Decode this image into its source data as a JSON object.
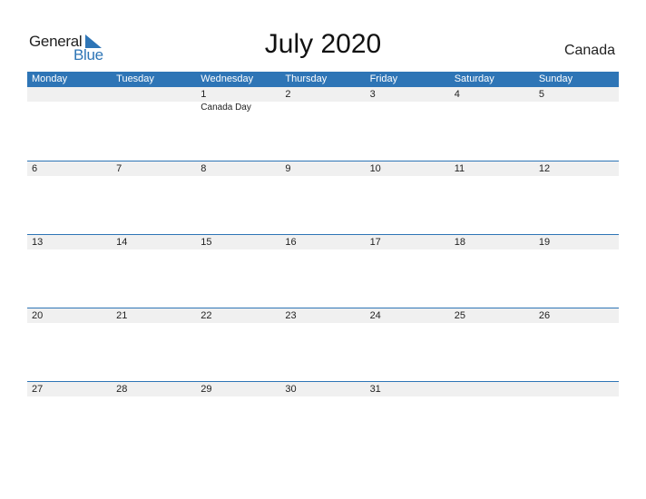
{
  "logo": {
    "word1": "General",
    "word2": "Blue"
  },
  "title": "July 2020",
  "country": "Canada",
  "colors": {
    "accent": "#2e75b6",
    "row_bg": "#f0f0f0"
  },
  "weekdays": [
    "Monday",
    "Tuesday",
    "Wednesday",
    "Thursday",
    "Friday",
    "Saturday",
    "Sunday"
  ],
  "weeks": [
    {
      "days": [
        "",
        "",
        "1",
        "2",
        "3",
        "4",
        "5"
      ],
      "events": [
        "",
        "",
        "Canada Day",
        "",
        "",
        "",
        ""
      ]
    },
    {
      "days": [
        "6",
        "7",
        "8",
        "9",
        "10",
        "11",
        "12"
      ],
      "events": [
        "",
        "",
        "",
        "",
        "",
        "",
        ""
      ]
    },
    {
      "days": [
        "13",
        "14",
        "15",
        "16",
        "17",
        "18",
        "19"
      ],
      "events": [
        "",
        "",
        "",
        "",
        "",
        "",
        ""
      ]
    },
    {
      "days": [
        "20",
        "21",
        "22",
        "23",
        "24",
        "25",
        "26"
      ],
      "events": [
        "",
        "",
        "",
        "",
        "",
        "",
        ""
      ]
    },
    {
      "days": [
        "27",
        "28",
        "29",
        "30",
        "31",
        "",
        ""
      ],
      "events": [
        "",
        "",
        "",
        "",
        "",
        "",
        ""
      ]
    }
  ]
}
